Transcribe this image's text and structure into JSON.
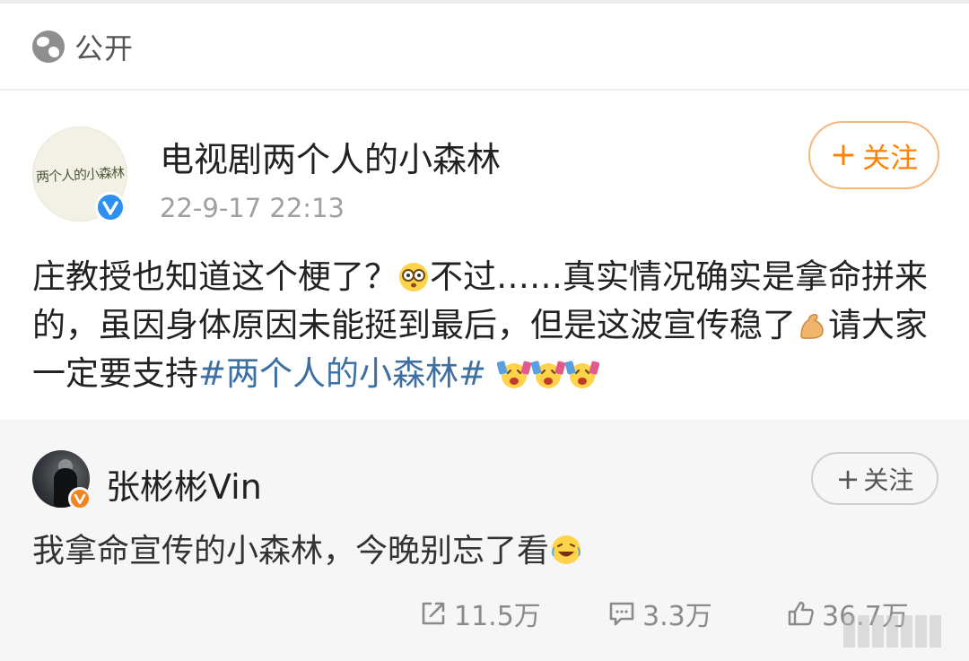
{
  "visibility": {
    "label": "公开",
    "icon": "globe-icon"
  },
  "author": {
    "name": "电视剧两个人的小森林",
    "time": "22-9-17 22:13",
    "avatar_text": "两个人的小森林",
    "verified": "blue-v-badge"
  },
  "follow_main": {
    "plus": "+",
    "label": "关注"
  },
  "post": {
    "part1": "庄教授也知道这个梗了？",
    "part2": "不过……真实情况确实是拿命拼来的，虽因身体原因未能挺到最后，但是这波宣传稳了",
    "part3": "请大家一定要支持",
    "hashtag": "#两个人的小森林#",
    "emojis": [
      "wow-emoji",
      "muscle-emoji",
      "cheer-emoji",
      "cheer-emoji",
      "cheer-emoji"
    ]
  },
  "repost": {
    "name": "张彬彬Vin",
    "text": "我拿命宣传的小森林，今晚别忘了看",
    "verified": "orange-v-badge",
    "emoji": "laugh-cry-emoji"
  },
  "follow_small": {
    "plus": "+",
    "label": "关注"
  },
  "stats": {
    "shares": "11.5万",
    "comments": "3.3万",
    "likes": "36.7万"
  },
  "colors": {
    "accent": "#ff8200",
    "hashtag": "#3d6fa3",
    "verified_blue": "#2d8ff0",
    "verified_orange": "#f08421"
  }
}
